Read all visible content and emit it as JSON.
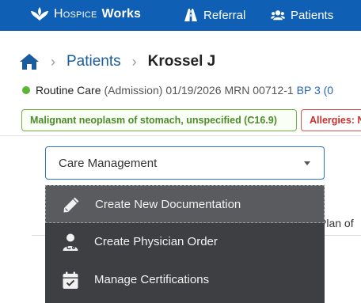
{
  "app": {
    "brand_part1": "Hospice",
    "brand_part2": "Works"
  },
  "nav": {
    "referral": "Referral",
    "patients": "Patients"
  },
  "breadcrumb": {
    "patients": "Patients",
    "current": "Krossel J"
  },
  "patient": {
    "status_color": "#5cb531",
    "care_type": "Routine Care",
    "admission": "(Admission)",
    "date": "01/19/2026",
    "mrn": "MRN 00712-1",
    "bp": "BP 3 (0"
  },
  "badges": {
    "diagnosis": "Malignant neoplasm of stomach, unspecified (C16.9)",
    "allergies": "Allergies: N"
  },
  "select": {
    "value": "Care Management"
  },
  "background": {
    "tab_partial": "Plan of"
  },
  "menu": {
    "items": [
      {
        "label": "Create New Documentation",
        "icon": "pencil-icon"
      },
      {
        "label": "Create Physician Order",
        "icon": "physician-icon"
      },
      {
        "label": "Manage Certifications",
        "icon": "calendar-check-icon"
      }
    ]
  },
  "colors": {
    "topbar": "#0f5fb5",
    "link": "#1a5d9e",
    "menu_bg": "#3d3f42",
    "menu_active": "#595b5e"
  }
}
